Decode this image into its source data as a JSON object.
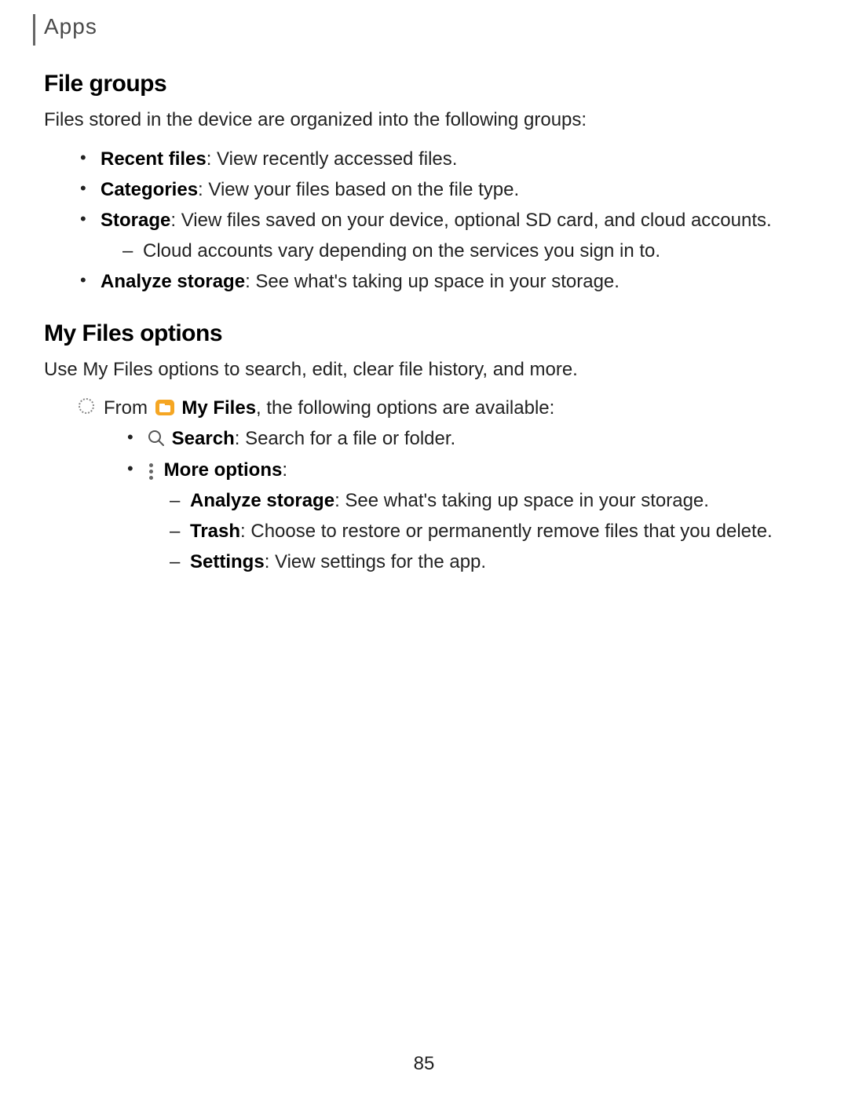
{
  "breadcrumb": "Apps",
  "sections": {
    "file_groups": {
      "heading": "File groups",
      "intro": "Files stored in the device are organized into the following groups:",
      "items": {
        "recent": {
          "label": "Recent files",
          "desc": ": View recently accessed files."
        },
        "categories": {
          "label": "Categories",
          "desc": ": View your files based on the file type."
        },
        "storage": {
          "label": "Storage",
          "desc": ": View files saved on your device, optional SD card, and cloud accounts.",
          "sub": "Cloud accounts vary depending on the services you sign in to."
        },
        "analyze": {
          "label": "Analyze storage",
          "desc": ": See what's taking up space in your storage."
        }
      }
    },
    "my_files_options": {
      "heading": "My Files options",
      "intro": "Use My Files options to search, edit, clear file history, and more.",
      "from_prefix": "From ",
      "my_files_label": "My Files",
      "from_suffix": ", the following options are available:",
      "options": {
        "search": {
          "label": "Search",
          "desc": ": Search for a file or folder."
        },
        "more": {
          "label": "More options",
          "colon": ":",
          "subs": {
            "analyze": {
              "label": "Analyze storage",
              "desc": ": See what's taking up space in your storage."
            },
            "trash": {
              "label": "Trash",
              "desc": ": Choose to restore or permanently remove files that you delete."
            },
            "settings": {
              "label": "Settings",
              "desc": ": View settings for the app."
            }
          }
        }
      }
    }
  },
  "page_number": "85"
}
